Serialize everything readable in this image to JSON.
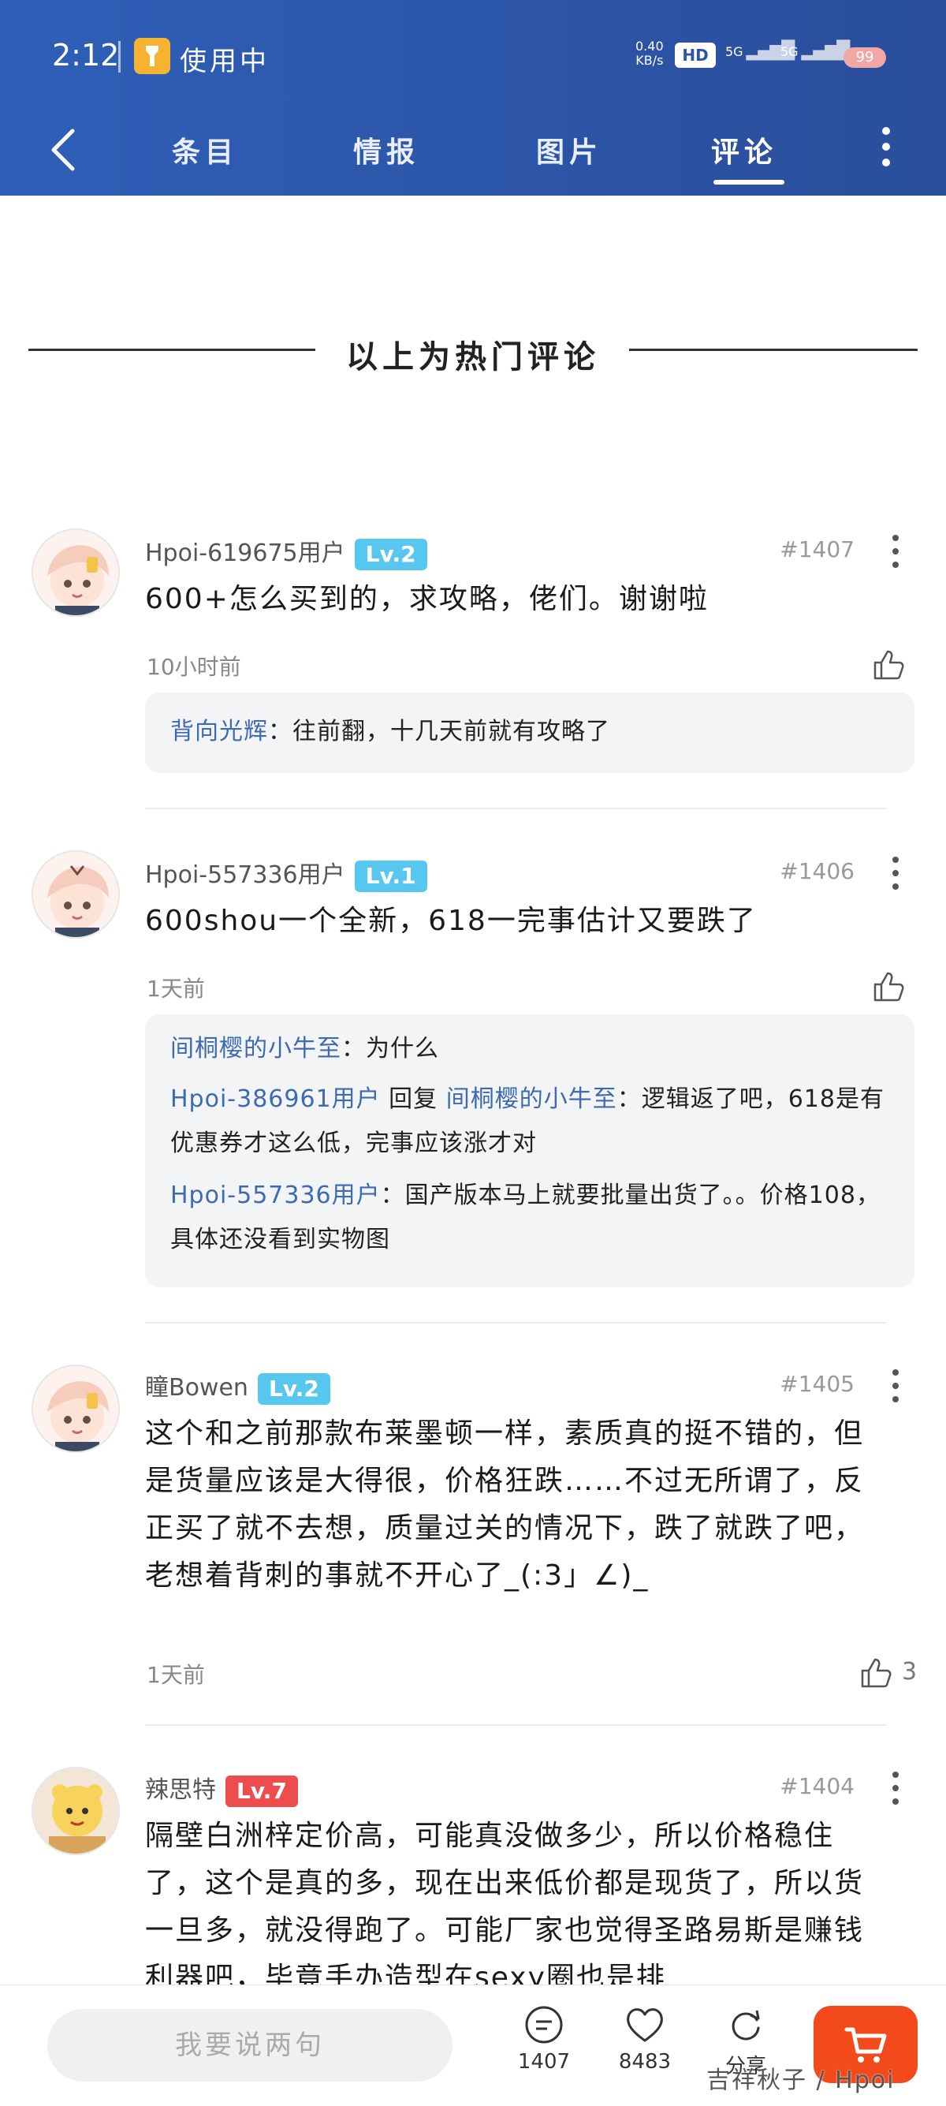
{
  "status_bar": {
    "time": "2:12",
    "in_use": "使用中",
    "net_speed_value": "0.40",
    "net_speed_unit": "KB/s",
    "hd_badge": "HD",
    "signal_1": "5G",
    "signal_2": "5G",
    "battery": "99"
  },
  "nav": {
    "tabs": [
      {
        "label": "条目"
      },
      {
        "label": "情报"
      },
      {
        "label": "图片"
      },
      {
        "label": "评论"
      }
    ],
    "active_tab": "评论"
  },
  "hot_divider": {
    "title": "以上为热门评论"
  },
  "comments": [
    {
      "user": "Hpoi-619675用户",
      "level": "Lv.2",
      "floor": "#1407",
      "text": "600+怎么买到的，求攻略，佬们。谢谢啦",
      "time": "10小时前",
      "likes": "",
      "replies": [
        {
          "author": "背向光辉",
          "text": "：往前翻，十几天前就有攻略了"
        }
      ]
    },
    {
      "user": "Hpoi-557336用户",
      "level": "Lv.1",
      "floor": "#1406",
      "text": "600shou一个全新，618一完事估计又要跌了",
      "time": "1天前",
      "likes": "",
      "replies": [
        {
          "author": "间桐樱的小牛至",
          "text": "：为什么"
        },
        {
          "author": "Hpoi-386961用户",
          "reply_word": " 回复 ",
          "target": "间桐樱的小牛至",
          "text": "：逻辑返了吧，618是有优惠券才这么低，完事应该涨才对"
        },
        {
          "author": "Hpoi-557336用户",
          "text": "：国产版本马上就要批量出货了。。价格108，具体还没看到实物图"
        }
      ]
    },
    {
      "user": "瞳Bowen",
      "level": "Lv.2",
      "floor": "#1405",
      "text": "这个和之前那款布莱墨顿一样，素质真的挺不错的，但是货量应该是大得很，价格狂跌……不过无所谓了，反正买了就不去想，质量过关的情况下，跌了就跌了吧，老想着背刺的事就不开心了_(:3」∠)_",
      "time": "1天前",
      "likes": "3"
    },
    {
      "user": "辣思特",
      "level": "Lv.7",
      "floor": "#1404",
      "text": "隔壁白洲梓定价高，可能真没做多少，所以价格稳住了，这个是真的多，现在出来低价都是现货了，所以货一旦多，就没得跑了。可能厂家也觉得圣路易斯是赚钱利器吧，毕竟手办造型在sexy圈也是排"
    }
  ],
  "bottom_bar": {
    "input_placeholder": "我要说两句",
    "comment_count": "1407",
    "favorite_count": "8483",
    "share_label": "分享"
  },
  "watermark": "吉祥秋子 / Hpoi",
  "colors": {
    "header_blue": "#2c55a8",
    "level_blue": "#58c7f0",
    "level_red": "#ee4d4d",
    "reply_name": "#3d6ab0",
    "cart_orange": "#f24a1a"
  }
}
